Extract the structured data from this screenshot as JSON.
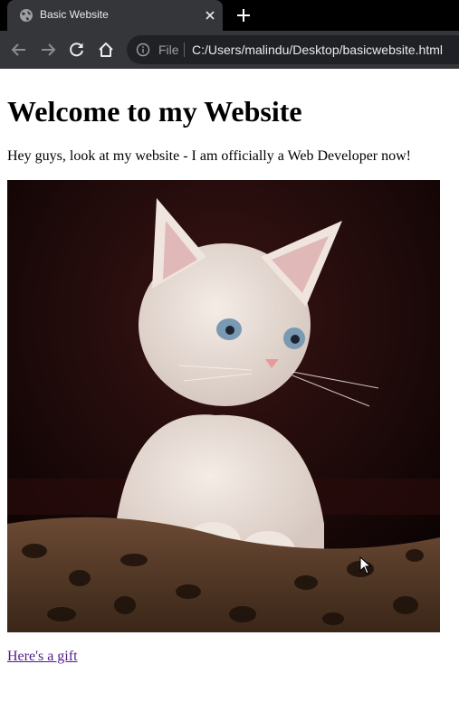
{
  "browser": {
    "tab": {
      "title": "Basic Website"
    },
    "omnibox": {
      "scheme_label": "File",
      "url": "C:/Users/malindu/Desktop/basicwebsite.html"
    },
    "icons": {
      "favicon": "globe-icon",
      "close": "close-icon",
      "new_tab": "plus-icon",
      "back": "back-arrow-icon",
      "forward": "forward-arrow-icon",
      "reload": "reload-icon",
      "home": "home-icon",
      "info": "info-icon"
    },
    "colors": {
      "tabstrip": "#000000",
      "toolbar": "#35363a",
      "omnibox": "#202124"
    }
  },
  "page": {
    "heading": "Welcome to my Website",
    "intro": "Hey guys, look at my website - I am officially a Web Developer now!",
    "image": {
      "subject": "kitten-photo"
    },
    "link": {
      "text": "Here's a gift",
      "color": "#551a8b"
    }
  }
}
